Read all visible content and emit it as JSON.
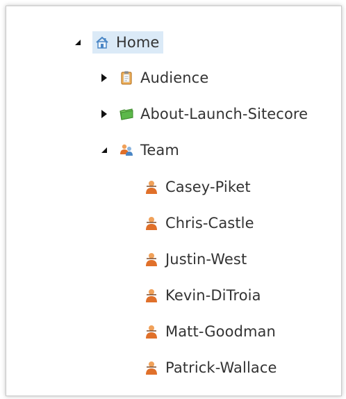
{
  "tree": {
    "home": {
      "label": "Home",
      "icon": "home-icon",
      "expanded": true,
      "selected": true
    },
    "children": [
      {
        "label": "Audience",
        "icon": "clipboard-icon",
        "expanded": false
      },
      {
        "label": "About-Launch-Sitecore",
        "icon": "folder-green-icon",
        "expanded": false
      },
      {
        "label": "Team",
        "icon": "team-icon",
        "expanded": true
      }
    ],
    "team_members": [
      {
        "label": "Casey-Piket",
        "icon": "person-icon"
      },
      {
        "label": "Chris-Castle",
        "icon": "person-icon"
      },
      {
        "label": "Justin-West",
        "icon": "person-icon"
      },
      {
        "label": "Kevin-DiTroia",
        "icon": "person-icon"
      },
      {
        "label": "Matt-Goodman",
        "icon": "person-icon"
      },
      {
        "label": "Patrick-Wallace",
        "icon": "person-icon"
      }
    ]
  },
  "colors": {
    "selection": "#dbeaf7",
    "text": "#333333",
    "person_orange": "#e0702a",
    "folder_green": "#5cb84a"
  }
}
